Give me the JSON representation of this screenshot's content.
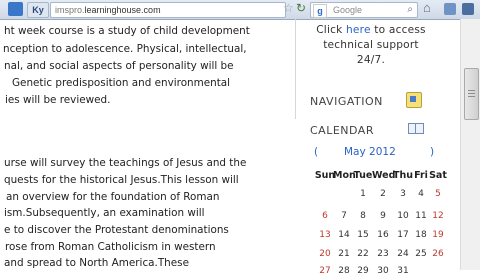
{
  "browser": {
    "tab_badge": "Ky",
    "url_prefix": "imspro.",
    "url_host": "learninghouse.com",
    "search_placeholder": "Google",
    "search_logo": "g-icon",
    "icons": [
      "star-icon",
      "reload-icon",
      "search-icon",
      "home-icon"
    ]
  },
  "article": {
    "lines": [
      "ht week course is a study of child development",
      "nception to adolescence. Physical, intellectual,",
      "nal, and social aspects of personality will be",
      "Genetic predisposition and environmental",
      "ies will be reviewed.",
      "urse will survey the teachings of Jesus and the",
      "quests for the historical Jesus.This lesson will",
      "an overview for the foundation of Roman",
      "ism.Subsequently, an examination will",
      "e to discover the Protestant denominations",
      "rose from Roman Catholicism in western",
      "and spread to North America.These"
    ]
  },
  "sidebar": {
    "support": {
      "line1_prefix": "Click ",
      "line1_link": "here",
      "line1_suffix": " to access",
      "line2": "technical support",
      "line3": "24/7."
    },
    "navigation_title": "NAVIGATION",
    "calendar_title": "CALENDAR",
    "calendar": {
      "prev": "(",
      "month": "May 2012",
      "next": ")",
      "weekdays": [
        "Sun",
        "Mon",
        "Tue",
        "Wed",
        "Thu",
        "Fri",
        "Sat"
      ],
      "weeks": [
        [
          "",
          "",
          "1",
          "2",
          "3",
          "4",
          "5"
        ],
        [
          "6",
          "7",
          "8",
          "9",
          "10",
          "11",
          "12"
        ],
        [
          "13",
          "14",
          "15",
          "16",
          "17",
          "18",
          "19"
        ],
        [
          "20",
          "21",
          "22",
          "23",
          "24",
          "25",
          "26"
        ],
        [
          "27",
          "28",
          "29",
          "30",
          "31",
          "",
          ""
        ]
      ],
      "colors": {
        "weekend": "#c0392b",
        "link": "#2a63c4"
      }
    }
  }
}
